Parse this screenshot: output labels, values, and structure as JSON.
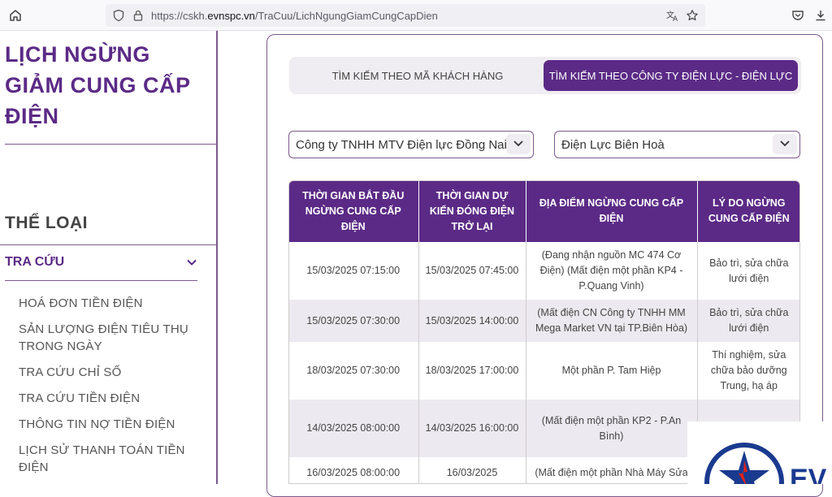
{
  "browser": {
    "url_prefix": "https://cskh.",
    "url_domain": "evnspc.vn",
    "url_path": "/TraCuu/LichNgungGiamCungCapDien"
  },
  "sidebar": {
    "title": "LỊCH NGỪNG GIẢM CUNG CẤP ĐIỆN",
    "category_heading": "THỂ LOẠI",
    "lookup_label": "TRA CỨU",
    "items": [
      "HOÁ ĐƠN TIỀN ĐIỆN",
      "SẢN LƯỢNG ĐIỆN TIÊU THỤ TRONG NGÀY",
      "TRA CỨU CHỈ SỐ",
      "TRA CỨU TIỀN ĐIỆN",
      "THÔNG TIN NỢ TIỀN ĐIỆN",
      "LỊCH SỬ THANH TOÁN TIỀN ĐIỆN"
    ]
  },
  "tabs": {
    "by_customer": "TÌM KIẾM THEO MÃ KHÁCH HÀNG",
    "by_company": "TÌM KIẾM THEO CÔNG TY ĐIỆN LỰC - ĐIỆN LỰC"
  },
  "filters": {
    "company": "Công ty TNHH MTV Điện lực Đồng Nai",
    "branch": "Điện Lực Biên Hoà"
  },
  "table": {
    "headers": [
      "THỜI GIAN BẮT ĐẦU NGỪNG CUNG CẤP ĐIỆN",
      "THỜI GIAN DỰ KIẾN ĐÓNG ĐIỆN TRỞ LẠI",
      "ĐỊA ĐIỂM NGỪNG CUNG CẤP ĐIỆN",
      "LÝ DO NGỪNG CUNG CẤP ĐIỆN"
    ],
    "rows": [
      [
        "15/03/2025 07:15:00",
        "15/03/2025 07:45:00",
        "(Đang nhận nguồn MC 474 Cơ Điện) (Mất điện một phần KP4 - P.Quang Vinh)",
        "Bảo trì, sửa chữa lưới điện"
      ],
      [
        "15/03/2025 07:30:00",
        "15/03/2025 14:00:00",
        "(Mất điện CN Công ty TNHH MM Mega Market VN tại TP.Biên Hòa)",
        "Bảo trì, sửa chữa lưới điện"
      ],
      [
        "18/03/2025 07:30:00",
        "18/03/2025 17:00:00",
        "Một phần P. Tam Hiệp",
        "Thí nghiệm, sửa chữa bảo dưỡng Trung, hạ áp"
      ],
      [
        "14/03/2025 08:00:00",
        "14/03/2025 16:00:00",
        "(Mất điện một phần KP2 - P.An Bình)",
        "Thí nghiệm, sửa"
      ],
      [
        "16/03/2025 08:00:00",
        "16/03/2025",
        "(Mất điện một phần Nhà Máy Sửa",
        ""
      ]
    ]
  },
  "logo": {
    "text": "EV"
  }
}
